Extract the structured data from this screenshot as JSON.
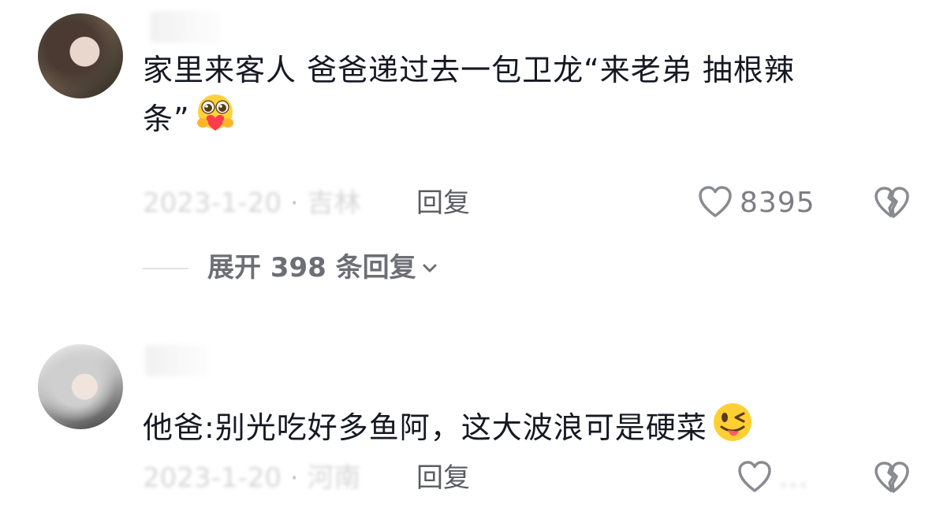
{
  "comments": [
    {
      "content": "家里来客人 爸爸递过去一包卫龙“来老弟 抽根辣\n条”",
      "emoji": "hug-heart-emoji",
      "date": "2023-1-20",
      "location": "吉林",
      "reply_label": "回复",
      "likes": "8395",
      "expand_label": "展开 398 条回复"
    },
    {
      "content": "他爸:别光吃好多鱼阿，这大波浪可是硬菜",
      "emoji": "tongue-wink-emoji",
      "date": "2023-1-20",
      "location": "河南",
      "reply_label": "回复",
      "likes": "..."
    }
  ],
  "colors": {
    "text_primary": "#161823",
    "text_meta": "#c7c8cc",
    "icon_gray": "#8a8b91"
  }
}
